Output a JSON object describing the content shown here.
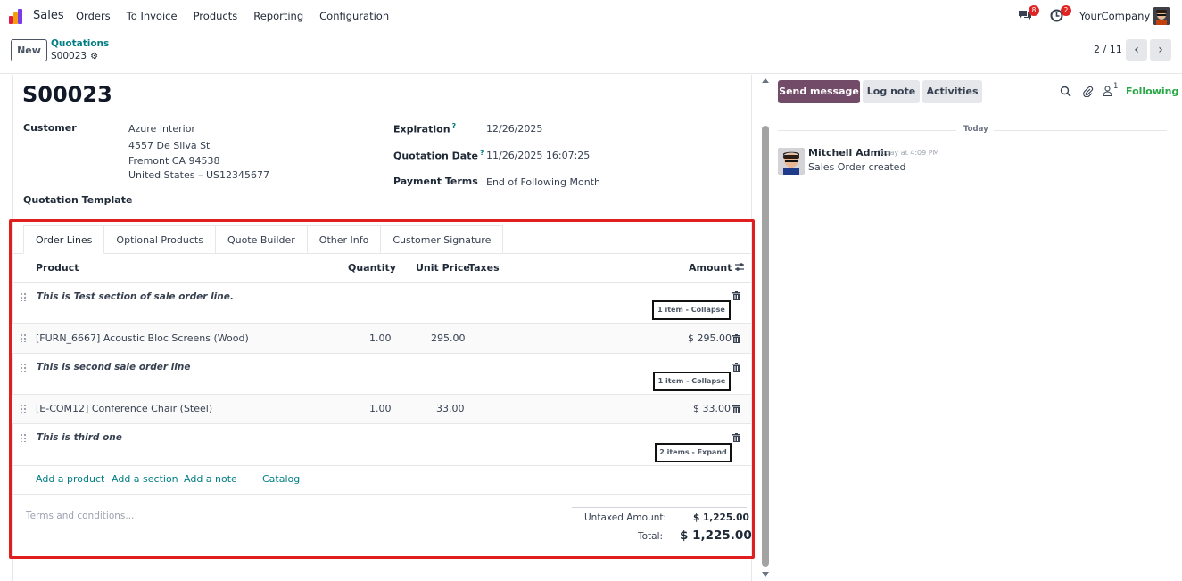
{
  "navbar": {
    "app_name": "Sales",
    "menu": [
      "Orders",
      "To Invoice",
      "Products",
      "Reporting",
      "Configuration"
    ],
    "messages_badge": "8",
    "activities_badge": "2",
    "company": "YourCompany"
  },
  "control": {
    "new_label": "New",
    "breadcrumb_parent": "Quotations",
    "breadcrumb_current": "S00023",
    "pager": "2 / 11"
  },
  "record": {
    "title": "S00023",
    "customer_label": "Customer",
    "customer_name": "Azure Interior",
    "customer_street": "4557 De Silva St",
    "customer_city": "Fremont CA 94538",
    "customer_country": "United States – US12345677",
    "template_label": "Quotation Template",
    "expiration_label": "Expiration",
    "expiration_value": "12/26/2025",
    "quotation_date_label": "Quotation Date",
    "quotation_date_value": "11/26/2025 16:07:25",
    "payment_terms_label": "Payment Terms",
    "payment_terms_value": "End of Following Month",
    "help_mark": "?"
  },
  "tabs": [
    "Order Lines",
    "Optional Products",
    "Quote Builder",
    "Other Info",
    "Customer Signature"
  ],
  "columns": {
    "product": "Product",
    "quantity": "Quantity",
    "unit_price": "Unit Price",
    "taxes": "Taxes",
    "amount": "Amount"
  },
  "lines": {
    "section1": "This is Test section of sale order line.",
    "section1_toggle": "1 item - Collapse",
    "product1": "[FURN_6667] Acoustic Bloc Screens (Wood)",
    "product1_qty": "1.00",
    "product1_price": "295.00",
    "product1_amount": "$ 295.00",
    "section2": "This is second sale order line",
    "section2_toggle": "1 item - Collapse",
    "product2": "[E-COM12] Conference Chair (Steel)",
    "product2_qty": "1.00",
    "product2_price": "33.00",
    "product2_amount": "$ 33.00",
    "section3": "This is third one",
    "section3_toggle": "2 items - Expand"
  },
  "add": {
    "product": "Add a product",
    "section": "Add a section",
    "note": "Add a note",
    "catalog": "Catalog"
  },
  "footer": {
    "terms_placeholder": "Terms and conditions...",
    "untaxed_label": "Untaxed Amount:",
    "untaxed_value": "$ 1,225.00",
    "total_label": "Total:",
    "total_value": "$ 1,225.00"
  },
  "chatter": {
    "send_message": "Send message",
    "log_note": "Log note",
    "activities": "Activities",
    "followers_count": "1",
    "following": "Following",
    "today": "Today",
    "author": "Mitchell Admin",
    "time": "Today at 4:09 PM",
    "body": "Sales Order created"
  },
  "colors": {
    "accent": "#017e84",
    "primary": "#714b67",
    "highlight": "#e01e1e",
    "following": "#28a745"
  }
}
